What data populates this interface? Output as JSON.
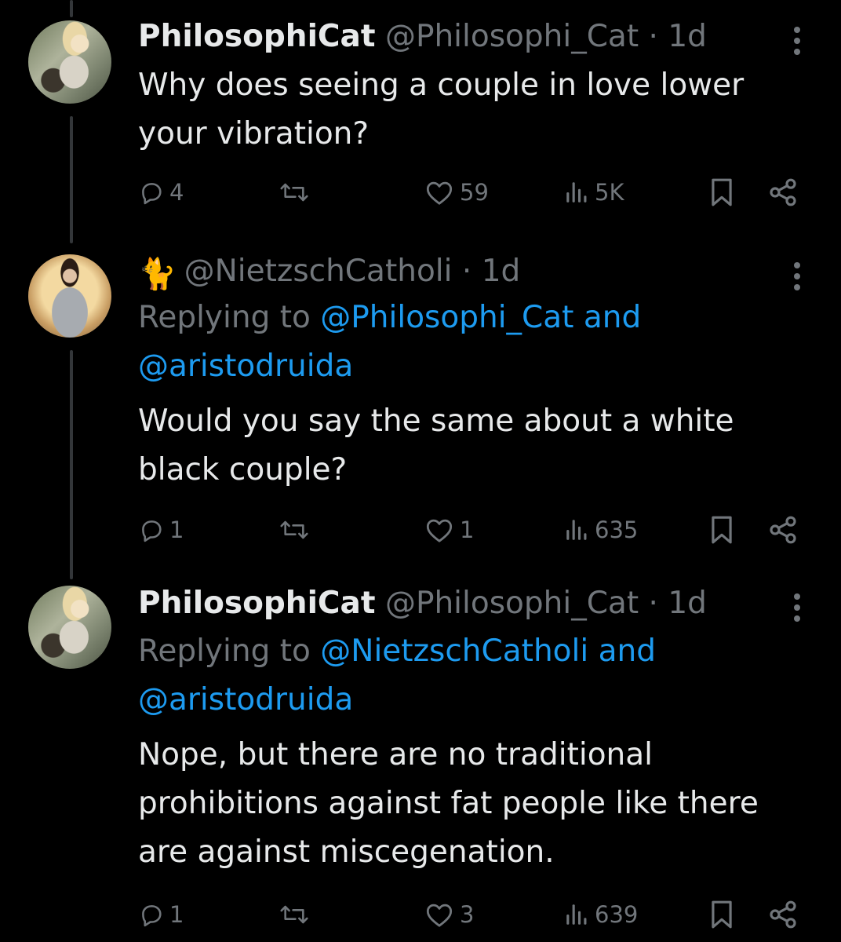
{
  "tweets": [
    {
      "display_name": "PhilosophiCat",
      "handle": "@Philosophi_Cat",
      "separator": "·",
      "time": "1d",
      "replying_prefix": "",
      "replying_to_1": "",
      "replying_and": "",
      "replying_to_2": "",
      "text_lines": [
        "Why does seeing a couple in love lower",
        "your vibration?"
      ],
      "replies": "4",
      "retweets": "",
      "likes": "59",
      "views": "5K"
    },
    {
      "display_name": "",
      "emoji": "🐈",
      "handle": "@NietzschCatholi",
      "separator": "·",
      "time": "1d",
      "replying_prefix": "Replying to",
      "replying_to_1": "@Philosophi_Cat",
      "replying_and": "and",
      "replying_to_2": "@aristodruida",
      "text_lines": [
        "Would you say the same about a white",
        "black couple?"
      ],
      "replies": "1",
      "retweets": "",
      "likes": "1",
      "views": "635"
    },
    {
      "display_name": "PhilosophiCat",
      "handle": "@Philosophi_Cat",
      "separator": "·",
      "time": "1d",
      "replying_prefix": "Replying to",
      "replying_to_1": "@NietzschCatholi",
      "replying_and": "and",
      "replying_to_2": "@aristodruida",
      "text_lines": [
        "Nope, but there are no traditional",
        "prohibitions against fat people like there",
        "are against miscegenation."
      ],
      "replies": "1",
      "retweets": "",
      "likes": "3",
      "views": "639"
    }
  ],
  "icons": {
    "reply": "reply-icon",
    "retweet": "retweet-icon",
    "like": "heart-icon",
    "views": "views-icon",
    "bookmark": "bookmark-icon",
    "share": "share-icon",
    "more": "more-icon"
  },
  "colors": {
    "background": "#000000",
    "primary_text": "#e7e9ea",
    "secondary_text": "#71767b",
    "link": "#1d9bf0",
    "thread_line": "#333639"
  }
}
